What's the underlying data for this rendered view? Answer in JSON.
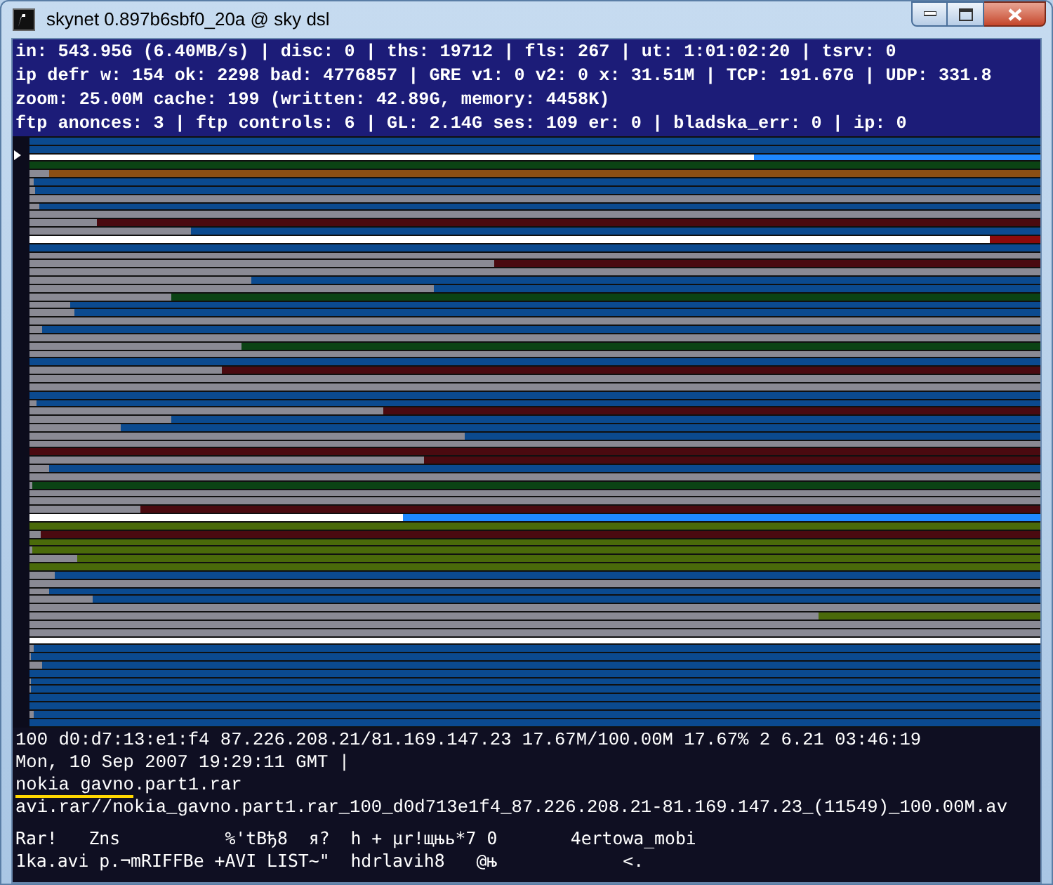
{
  "window": {
    "title": "skynet 0.897b6sbf0_20a @ sky dsl"
  },
  "stats_lines": [
    "in: 543.95G (6.40MB/s) | disc: 0 | ths: 19712 | fls: 267 | ut: 1:01:02:20 | tsrv: 0",
    "ip defr w: 154 ok: 2298 bad: 4776857 | GRE v1: 0 v2: 0 x: 31.51M | TCP: 191.67G | UDP: 331.8",
    "zoom: 25.00M cache: 199 (written: 42.89G, memory: 4458K)",
    "ftp anonces: 3 | ftp controls: 6 | GL: 2.14G ses: 109 er: 0 | bladska_err: 0 | ip: 0"
  ],
  "bars": [
    {
      "color": "#0b4a8f"
    },
    {
      "color": "#0b4a8f"
    },
    {
      "kind": "highlight",
      "level": 0.716,
      "color": "#1e88ff"
    },
    {
      "color": "#0b4314"
    },
    {
      "level": 0.02,
      "color": "#8b4f14"
    },
    {
      "level": 0.004,
      "color": "#0b4a8f"
    },
    {
      "level": 0.006,
      "color": "#0b4a8f"
    },
    {
      "level": 1
    },
    {
      "level": 0.01,
      "color": "#0b4a8f"
    },
    {
      "level": 1
    },
    {
      "level": 0.067,
      "color": "#4a0a10"
    },
    {
      "level": 0.16,
      "color": "#0b4a8f"
    },
    {
      "kind": "highlight",
      "level": 0.95,
      "color": "#8b0a0a"
    },
    {
      "color": "#0b4a8f"
    },
    {
      "level": 1
    },
    {
      "level": 0.46,
      "color": "#4a0a10"
    },
    {
      "level": 1
    },
    {
      "level": 0.22,
      "color": "#0b4a8f"
    },
    {
      "level": 0.4,
      "color": "#0b4a8f"
    },
    {
      "level": 0.14,
      "color": "#0b4314"
    },
    {
      "level": 0.04,
      "color": "#0b4a8f"
    },
    {
      "level": 0.045,
      "color": "#0b4a8f"
    },
    {
      "level": 1
    },
    {
      "level": 0.013,
      "color": "#0b4a8f"
    },
    {
      "level": 1
    },
    {
      "level": 0.21,
      "color": "#0b4314"
    },
    {
      "level": 1
    },
    {
      "color": "#0b4a8f"
    },
    {
      "level": 0.19,
      "color": "#4a0a10"
    },
    {
      "level": 1
    },
    {
      "level": 1
    },
    {
      "color": "#0b4a8f"
    },
    {
      "level": 0.007,
      "color": "#0b4a8f"
    },
    {
      "level": 0.35,
      "color": "#4a0a10"
    },
    {
      "level": 0.14,
      "color": "#0b4a8f"
    },
    {
      "level": 0.09,
      "color": "#0b4a8f"
    },
    {
      "level": 0.43,
      "color": "#0b4a8f"
    },
    {
      "level": 1
    },
    {
      "color": "#4a0a10"
    },
    {
      "level": 0.39,
      "color": "#4a0a10"
    },
    {
      "level": 0.02,
      "color": "#0b4a8f"
    },
    {
      "level": 1
    },
    {
      "level": 0.003,
      "color": "#0b4314"
    },
    {
      "level": 1
    },
    {
      "level": 1
    },
    {
      "level": 0.11,
      "color": "#4a0a10"
    },
    {
      "kind": "highlight",
      "level": 0.37,
      "color": "#1e88ff"
    },
    {
      "color": "#4a6a0a"
    },
    {
      "level": 0.011,
      "color": "#4a0a10"
    },
    {
      "color": "#4a6a0a"
    },
    {
      "level": 0.003,
      "color": "#4a6a0a"
    },
    {
      "level": 0.047,
      "color": "#4a6a0a"
    },
    {
      "color": "#4a6a0a"
    },
    {
      "level": 0.025,
      "color": "#0b4a8f"
    },
    {
      "level": 1
    },
    {
      "level": 0.02,
      "color": "#0b4a8f"
    },
    {
      "level": 0.062,
      "color": "#0b4a8f"
    },
    {
      "level": 1
    },
    {
      "level": 0.78,
      "color": "#4a6a0a"
    },
    {
      "level": 1
    },
    {
      "level": 1
    },
    {
      "kind": "highlight",
      "level": 1
    },
    {
      "level": 0.004,
      "color": "#0b4a8f"
    },
    {
      "level": 0.002,
      "color": "#0b4a8f"
    },
    {
      "level": 0.012,
      "color": "#0b4a8f"
    },
    {
      "color": "#0b4a8f"
    },
    {
      "level": 0.002,
      "color": "#0b4a8f"
    },
    {
      "level": 0.002,
      "color": "#0b4a8f"
    },
    {
      "color": "#0b4a8f"
    },
    {
      "color": "#0b4a8f"
    },
    {
      "level": 0.004,
      "color": "#0b4a8f"
    },
    {
      "color": "#0b4a8f"
    }
  ],
  "info_lines": [
    "100 d0:d7:13:e1:f4 87.226.208.21/81.169.147.23 17.67M/100.00M 17.67% 2 6.21 03:46:19",
    "Mon, 10 Sep 2007 19:29:11 GMT |"
  ],
  "file_line": {
    "highlighted": "nokia gavno",
    "rest": ".part1.rar"
  },
  "path_line": "avi.rar//nokia_gavno.part1.rar_100_d0d713e1f4_87.226.208.21-81.169.147.23_(11549)_100.00M.av",
  "dump_lines": [
    "Rar!   Zns          %'tBђ8  я?  h + µr!щњь*7 0       4ertowa_mobi",
    "1ka.avi р.¬mRIFFBe +AVI LIST~\"  hdrlavih8   @њ            <."
  ]
}
